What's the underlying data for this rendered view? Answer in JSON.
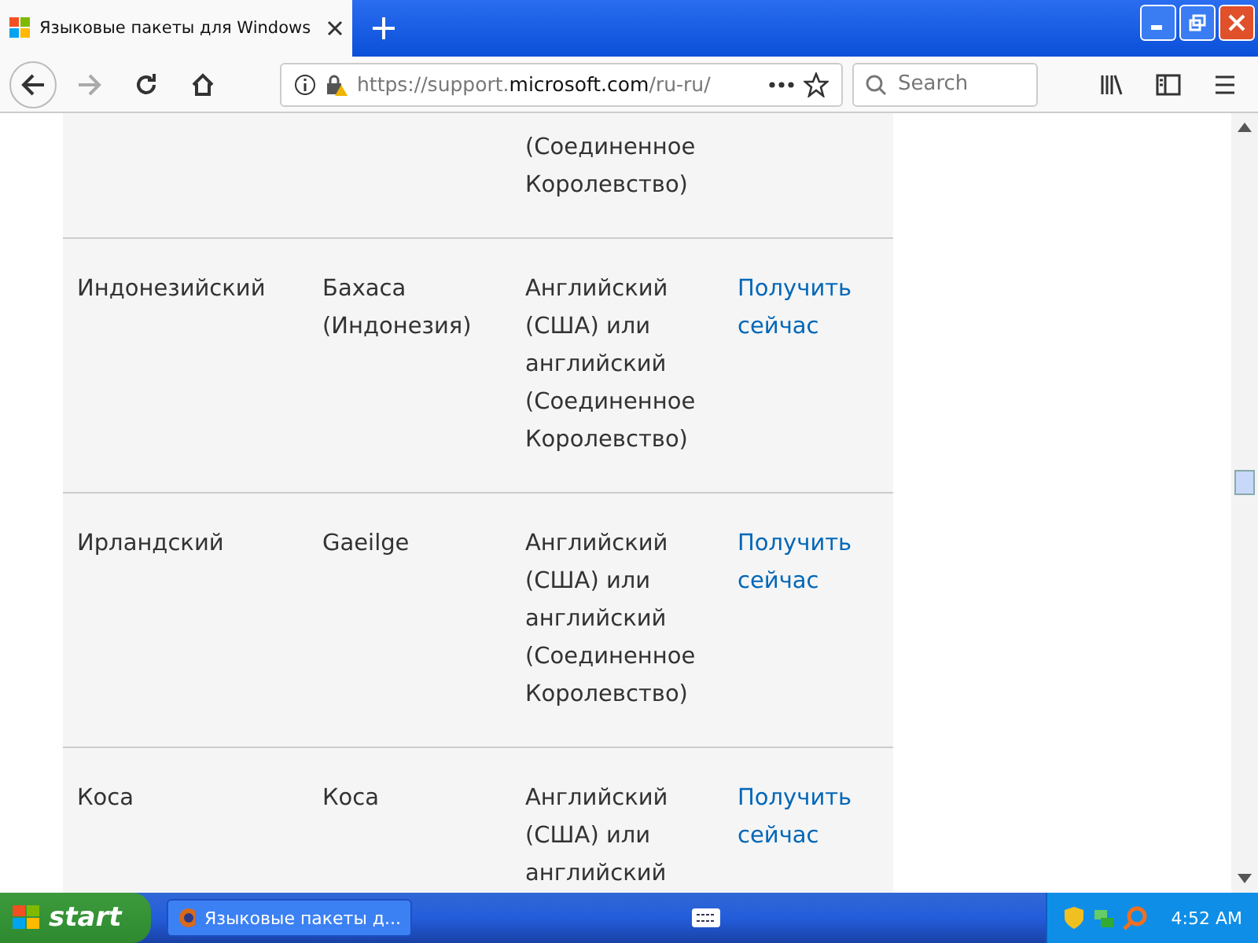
{
  "browser": {
    "tab_title": "Языковые пакеты для Windows",
    "url_prefix": "https://support.",
    "url_domain": "microsoft.com",
    "url_path": "/ru-ru/",
    "search": {
      "placeholder": "Search"
    }
  },
  "table": {
    "rows": [
      {
        "language": "",
        "native": "",
        "base": "(Соединенное Королевство)",
        "link": ""
      },
      {
        "language": "Индонезийский",
        "native": "Бахаса (Индонезия)",
        "base": "Английский (США) или английский (Соединенное Королевство)",
        "link": "Получить сейчас"
      },
      {
        "language": "Ирландский",
        "native": "Gaeilge",
        "base": "Английский (США) или английский (Соединенное Королевство)",
        "link": "Получить сейчас"
      },
      {
        "language": "Коса",
        "native": "Коса",
        "base": "Английский (США) или английский",
        "link": "Получить сейчас"
      }
    ]
  },
  "taskbar": {
    "start": "start",
    "task": "Языковые пакеты д...",
    "clock": "4:52 AM"
  }
}
